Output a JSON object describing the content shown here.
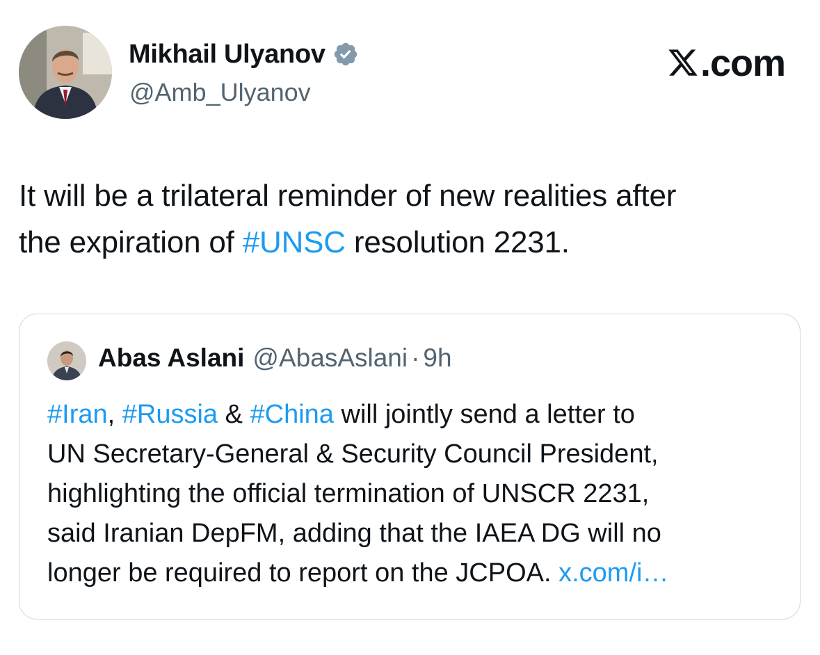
{
  "author": {
    "display_name": "Mikhail Ulyanov",
    "handle": "@Amb_Ulyanov",
    "verified": true
  },
  "brand": {
    "label": ".com",
    "icon": "x-logo-icon"
  },
  "tweet": {
    "line1": "It will be a trilateral reminder of new realities after",
    "line2_before": "the expiration  of ",
    "line2_tag": "#UNSC",
    "line2_after": " resolution 2231."
  },
  "quoted": {
    "display_name": "Abas Aslani",
    "handle": "@AbasAslani",
    "separator": "·",
    "time": "9h",
    "text": {
      "tag_iran": "#Iran",
      "comma": ", ",
      "tag_russia": "#Russia",
      "amp": " & ",
      "tag_china": "#China",
      "line1_rest": " will jointly send a letter to",
      "line2": "UN Secretary-General & Security Council President,",
      "line3": "highlighting the official termination of UNSCR 2231,",
      "line4": "said Iranian DepFM, adding that the IAEA DG will no",
      "line5": "longer be required to report on the JCPOA. ",
      "link": "x.com/i…"
    }
  },
  "colors": {
    "link": "#1d9bf0",
    "text": "#0f1419",
    "secondary": "#536471",
    "border": "#cfd9de",
    "verified_badge": "#829aab"
  }
}
